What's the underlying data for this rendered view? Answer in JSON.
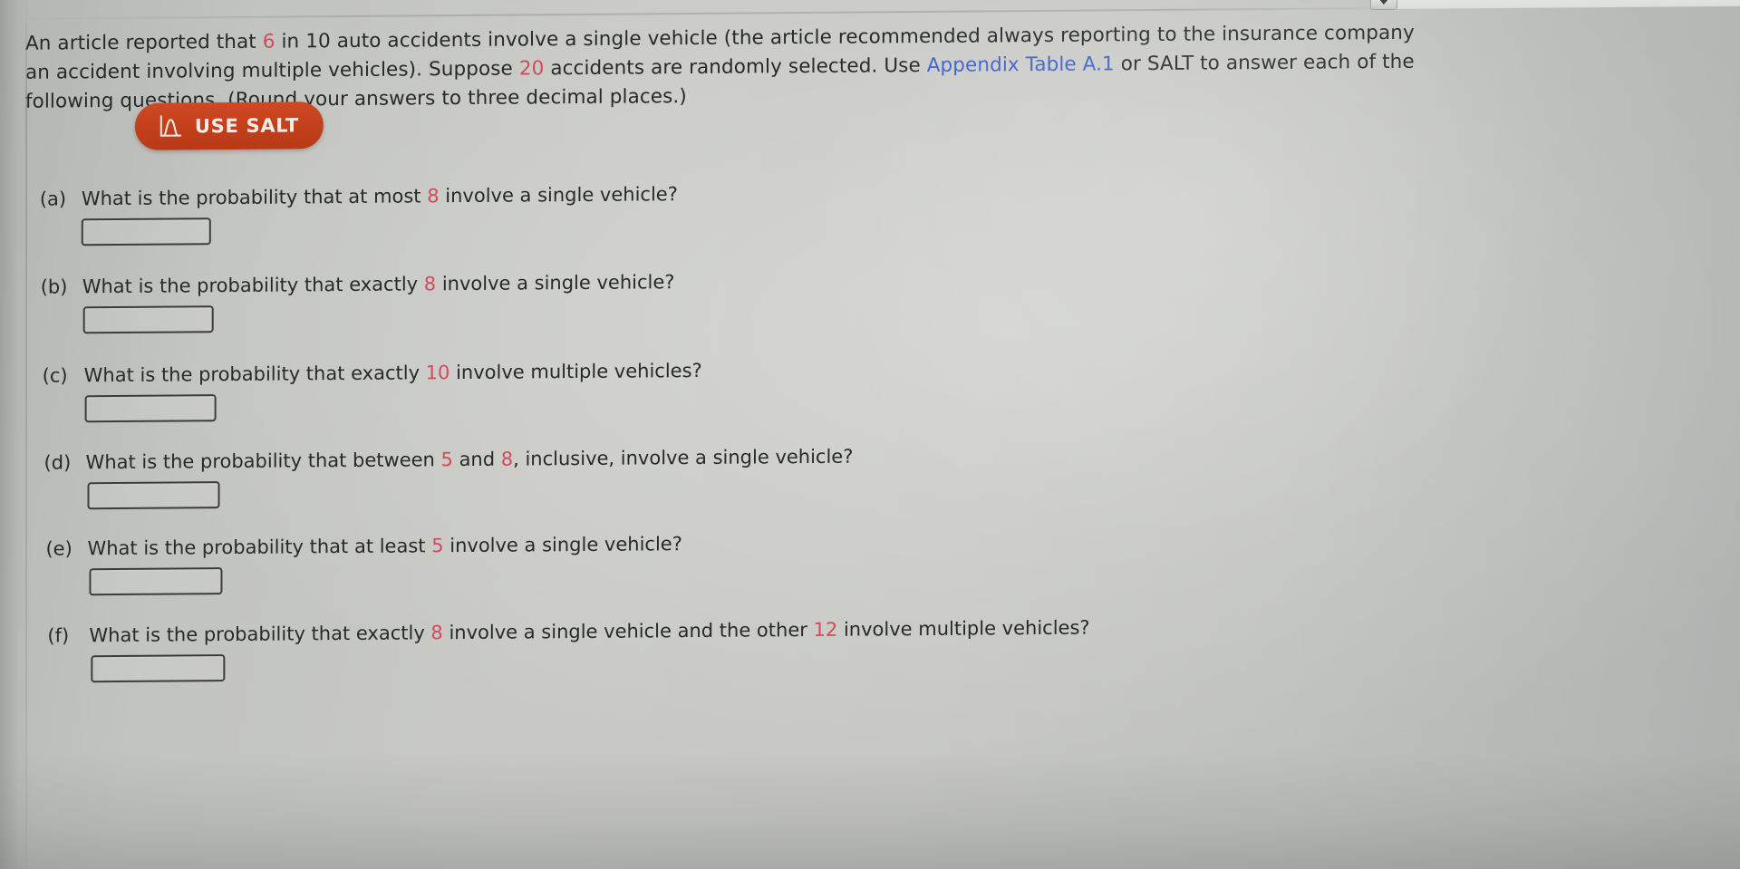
{
  "scrollbar": {
    "arrow_icon": "chevron-down-icon",
    "thumb_color": "#2f83c6"
  },
  "prompt": {
    "part1": "An article reported that ",
    "n1": "6",
    "part2": " in 10 auto accidents involve a single vehicle (the article recommended always reporting to the insurance company an accident involving multiple vehicles). Suppose ",
    "n2": "20",
    "part3": " accidents are randomly selected. Use ",
    "link": "Appendix Table A.1",
    "part4": " or SALT to answer each of the following questions. (Round your answers to three decimal places.)"
  },
  "salt_button": {
    "label": "USE SALT",
    "icon": "distribution-curve-icon",
    "color": "#c4411c"
  },
  "questions": [
    {
      "letter": "(a)",
      "before": "What is the probability that at most ",
      "value": "8",
      "after": " involve a single vehicle?",
      "answer": "",
      "placeholder": ""
    },
    {
      "letter": "(b)",
      "before": "What is the probability that exactly ",
      "value": "8",
      "after": " involve a single vehicle?",
      "answer": "",
      "placeholder": ""
    },
    {
      "letter": "(c)",
      "before": "What is the probability that exactly ",
      "value": "10",
      "after": " involve multiple vehicles?",
      "answer": "",
      "placeholder": ""
    },
    {
      "letter": "(d)",
      "before": "What is the probability that between ",
      "value": "5",
      "mid": " and ",
      "value2": "8",
      "after": ", inclusive, involve a single vehicle?",
      "answer": "",
      "placeholder": ""
    },
    {
      "letter": "(e)",
      "before": "What is the probability that at least ",
      "value": "5",
      "after": " involve a single vehicle?",
      "answer": "",
      "placeholder": ""
    },
    {
      "letter": "(f)",
      "before": "What is the probability that exactly ",
      "value": "8",
      "mid": " involve a single vehicle and the other ",
      "value2": "12",
      "after": " involve multiple vehicles?",
      "answer": "",
      "placeholder": ""
    }
  ]
}
